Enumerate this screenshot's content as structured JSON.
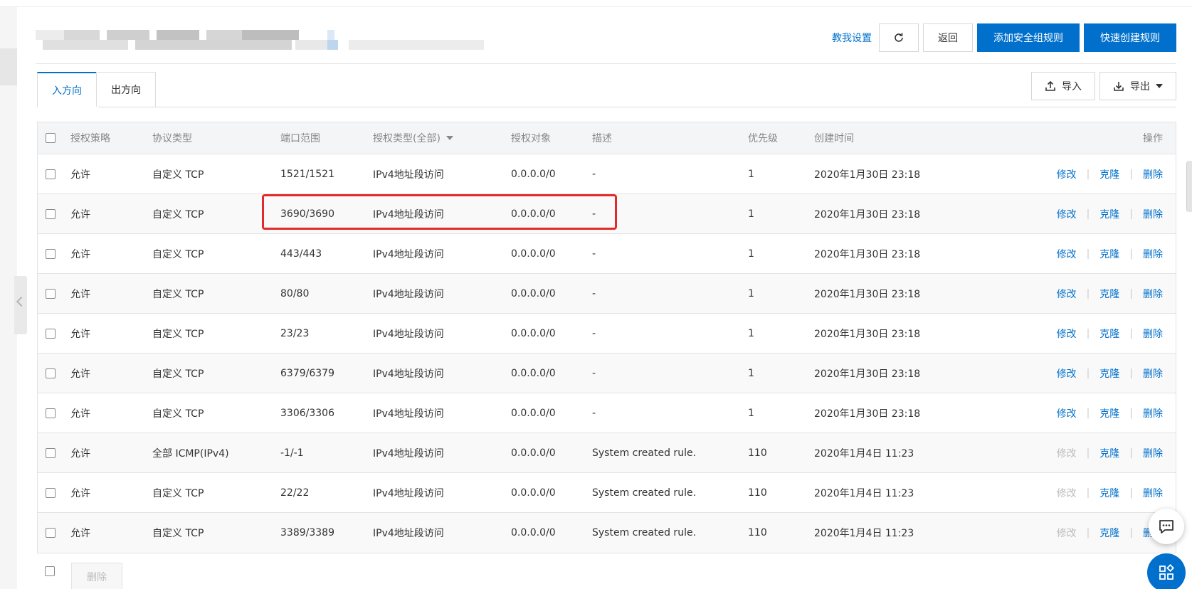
{
  "header": {
    "teach_link": "教我设置",
    "back_button": "返回",
    "add_rule_button": "添加安全组规则",
    "quick_create_button": "快速创建规则"
  },
  "tabs": [
    {
      "label": "入方向",
      "active": true
    },
    {
      "label": "出方向",
      "active": false
    }
  ],
  "io": {
    "import_label": "导入",
    "export_label": "导出"
  },
  "table": {
    "columns": {
      "policy": "授权策略",
      "protocol": "协议类型",
      "port": "端口范围",
      "auth_type": "授权类型(全部)",
      "target": "授权对象",
      "desc": "描述",
      "priority": "优先级",
      "created": "创建时间",
      "ops": "操作"
    },
    "ops_labels": {
      "edit": "修改",
      "clone": "克隆",
      "delete": "删除"
    },
    "rows": [
      {
        "policy": "允许",
        "protocol": "自定义 TCP",
        "port": "1521/1521",
        "auth_type": "IPv4地址段访问",
        "target": "0.0.0.0/0",
        "desc": "-",
        "priority": "1",
        "created": "2020年1月30日 23:18",
        "edit_disabled": false
      },
      {
        "policy": "允许",
        "protocol": "自定义 TCP",
        "port": "3690/3690",
        "auth_type": "IPv4地址段访问",
        "target": "0.0.0.0/0",
        "desc": "-",
        "priority": "1",
        "created": "2020年1月30日 23:18",
        "edit_disabled": false
      },
      {
        "policy": "允许",
        "protocol": "自定义 TCP",
        "port": "443/443",
        "auth_type": "IPv4地址段访问",
        "target": "0.0.0.0/0",
        "desc": "-",
        "priority": "1",
        "created": "2020年1月30日 23:18",
        "edit_disabled": false
      },
      {
        "policy": "允许",
        "protocol": "自定义 TCP",
        "port": "80/80",
        "auth_type": "IPv4地址段访问",
        "target": "0.0.0.0/0",
        "desc": "-",
        "priority": "1",
        "created": "2020年1月30日 23:18",
        "edit_disabled": false
      },
      {
        "policy": "允许",
        "protocol": "自定义 TCP",
        "port": "23/23",
        "auth_type": "IPv4地址段访问",
        "target": "0.0.0.0/0",
        "desc": "-",
        "priority": "1",
        "created": "2020年1月30日 23:18",
        "edit_disabled": false
      },
      {
        "policy": "允许",
        "protocol": "自定义 TCP",
        "port": "6379/6379",
        "auth_type": "IPv4地址段访问",
        "target": "0.0.0.0/0",
        "desc": "-",
        "priority": "1",
        "created": "2020年1月30日 23:18",
        "edit_disabled": false
      },
      {
        "policy": "允许",
        "protocol": "自定义 TCP",
        "port": "3306/3306",
        "auth_type": "IPv4地址段访问",
        "target": "0.0.0.0/0",
        "desc": "-",
        "priority": "1",
        "created": "2020年1月30日 23:18",
        "edit_disabled": false
      },
      {
        "policy": "允许",
        "protocol": "全部 ICMP(IPv4)",
        "port": "-1/-1",
        "auth_type": "IPv4地址段访问",
        "target": "0.0.0.0/0",
        "desc": "System created rule.",
        "priority": "110",
        "created": "2020年1月4日 11:23",
        "edit_disabled": true
      },
      {
        "policy": "允许",
        "protocol": "自定义 TCP",
        "port": "22/22",
        "auth_type": "IPv4地址段访问",
        "target": "0.0.0.0/0",
        "desc": "System created rule.",
        "priority": "110",
        "created": "2020年1月4日 11:23",
        "edit_disabled": true
      },
      {
        "policy": "允许",
        "protocol": "自定义 TCP",
        "port": "3389/3389",
        "auth_type": "IPv4地址段访问",
        "target": "0.0.0.0/0",
        "desc": "System created rule.",
        "priority": "110",
        "created": "2020年1月4日 11:23",
        "edit_disabled": true
      }
    ]
  },
  "footer": {
    "delete_button": "删除"
  },
  "icons": {
    "refresh": "refresh-icon",
    "upload": "upload-icon",
    "download": "download-icon",
    "chat": "chat-icon",
    "grid": "grid-icon"
  },
  "colors": {
    "accent": "#0070cc",
    "highlight": "#e3292a"
  }
}
